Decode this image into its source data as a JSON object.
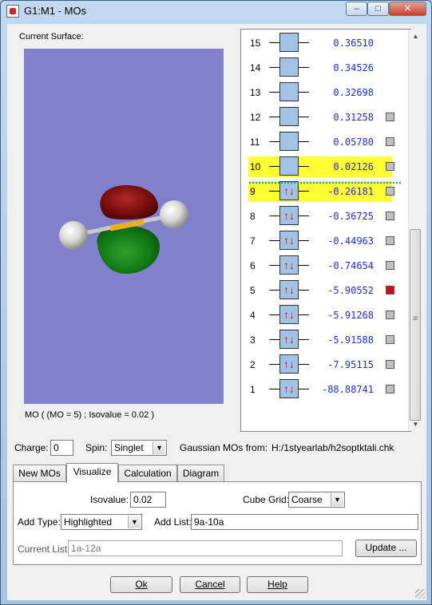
{
  "window": {
    "title": "G1:M1 - MOs",
    "minimize": "–",
    "maximize": "□",
    "close": "✕"
  },
  "surface": {
    "label": "Current Surface:",
    "caption": "MO ( (MO = 5) ; Isovalue = 0.02 )",
    "background_color": "#8080cc"
  },
  "orbitals": [
    {
      "n": "15",
      "energy": "0.36510",
      "occupied": false,
      "highlighted": false,
      "check": null
    },
    {
      "n": "14",
      "energy": "0.34526",
      "occupied": false,
      "highlighted": false,
      "check": null
    },
    {
      "n": "13",
      "energy": "0.32698",
      "occupied": false,
      "highlighted": false,
      "check": null
    },
    {
      "n": "12",
      "energy": "0.31258",
      "occupied": false,
      "highlighted": false,
      "check": "off"
    },
    {
      "n": "11",
      "energy": "0.05780",
      "occupied": false,
      "highlighted": false,
      "check": "off"
    },
    {
      "n": "10",
      "energy": "0.02126",
      "occupied": false,
      "highlighted": true,
      "check": "off"
    },
    {
      "n": "9",
      "energy": "-0.26181",
      "occupied": true,
      "highlighted": true,
      "check": "off"
    },
    {
      "n": "8",
      "energy": "-0.36725",
      "occupied": true,
      "highlighted": false,
      "check": "off"
    },
    {
      "n": "7",
      "energy": "-0.44963",
      "occupied": true,
      "highlighted": false,
      "check": "off"
    },
    {
      "n": "6",
      "energy": "-0.74654",
      "occupied": true,
      "highlighted": false,
      "check": "off"
    },
    {
      "n": "5",
      "energy": "-5.90552",
      "occupied": true,
      "highlighted": false,
      "check": "on"
    },
    {
      "n": "4",
      "energy": "-5.91268",
      "occupied": true,
      "highlighted": false,
      "check": "off"
    },
    {
      "n": "3",
      "energy": "-5.91588",
      "occupied": true,
      "highlighted": false,
      "check": "off"
    },
    {
      "n": "2",
      "energy": "-7.95115",
      "occupied": true,
      "highlighted": false,
      "check": "off"
    },
    {
      "n": "1",
      "energy": "-88.88741",
      "occupied": true,
      "highlighted": false,
      "check": "off"
    }
  ],
  "electron_glyphs": {
    "up": "↑",
    "down": "↓"
  },
  "controls": {
    "charge_label": "Charge:",
    "charge_value": "0",
    "spin_label": "Spin:",
    "spin_value": "Singlet",
    "source_label": "Gaussian MOs from:",
    "source_path": "H:/1styearlab/h2soptktali.chk"
  },
  "tabs": [
    "New MOs",
    "Visualize",
    "Calculation",
    "Diagram"
  ],
  "visualize": {
    "isovalue_label": "Isovalue:",
    "isovalue": "0.02",
    "cube_grid_label": "Cube Grid:",
    "cube_grid": "Coarse",
    "add_type_label": "Add Type:",
    "add_type": "Highlighted",
    "add_list_label": "Add List:",
    "add_list": "9a-10a",
    "current_list_label": "Current List:",
    "current_list": "1a-12a",
    "update_button": "Update ..."
  },
  "buttons": {
    "ok": "Ok",
    "cancel": "Cancel",
    "help": "Help"
  },
  "dropdown_arrow": "▼",
  "scroll": {
    "up": "▲",
    "down": "▼",
    "grip": "≡"
  }
}
